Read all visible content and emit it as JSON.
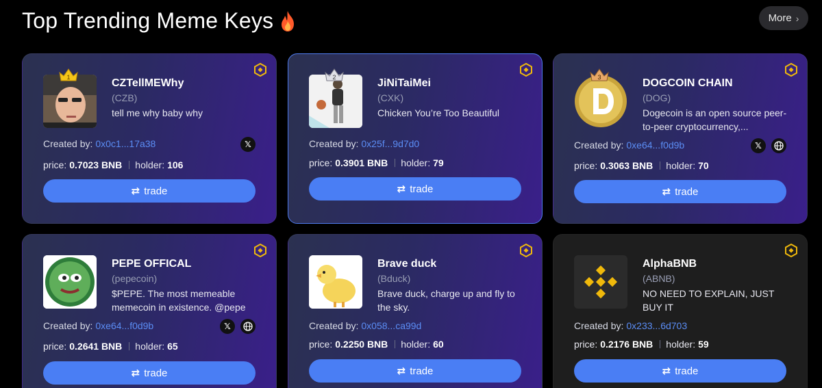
{
  "header": {
    "title": "Top Trending Meme Keys",
    "more_label": "More"
  },
  "created_label": "Created by:",
  "price_label": "price:",
  "holder_label": "holder:",
  "trade_label": "trade",
  "cards": [
    {
      "rank": "1",
      "name": "CZTellMEWhy",
      "symbol": "(CZB)",
      "desc": "tell me why baby why",
      "creator": "0x0c1...17a38",
      "price": "0.7023 BNB",
      "holder": "106"
    },
    {
      "rank": "2",
      "name": "JiNiTaiMei",
      "symbol": "(CXK)",
      "desc": "Chicken You’re Too Beautiful",
      "creator": "0x25f...9d7d0",
      "price": "0.3901 BNB",
      "holder": "79"
    },
    {
      "rank": "3",
      "name": "DOGCOIN CHAIN",
      "symbol": "(DOG)",
      "desc": "Dogecoin is an open source peer-to-peer cryptocurrency,...",
      "creator": "0xe64...f0d9b",
      "price": "0.3063 BNB",
      "holder": "70"
    },
    {
      "name": "PEPE OFFICAL",
      "symbol": "(pepecoin)",
      "desc": "$PEPE. The most memeable memecoin in existence. @pepe",
      "creator": "0xe64...f0d9b",
      "price": "0.2641 BNB",
      "holder": "65"
    },
    {
      "name": "Brave duck",
      "symbol": "(Bduck)",
      "desc": "Brave duck, charge up and fly to the sky.",
      "creator": "0x058...ca99d",
      "price": "0.2250 BNB",
      "holder": "60"
    },
    {
      "name": "AlphaBNB",
      "symbol": "(ABNB)",
      "desc": "NO NEED TO EXPLAIN, JUST BUY IT",
      "creator": "0x233...6d703",
      "price": "0.2176 BNB",
      "holder": "59"
    }
  ],
  "socials": {
    "x": "X",
    "web": "web"
  },
  "colors": {
    "accent": "#4a7ef4",
    "address": "#5b8df5",
    "bnb": "#f0b90b"
  }
}
